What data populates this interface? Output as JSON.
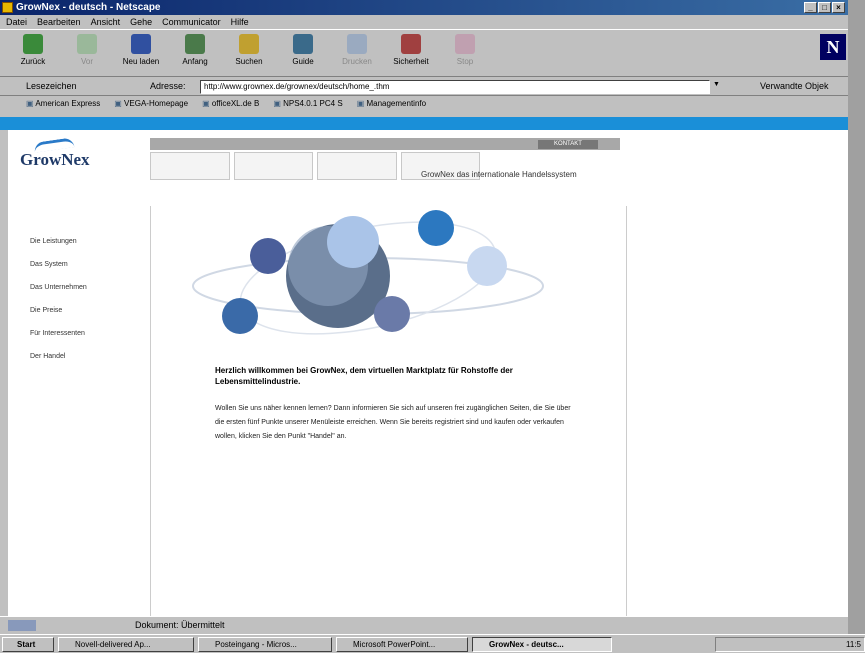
{
  "window": {
    "title": "GrowNex - deutsch - Netscape"
  },
  "menu": [
    "Datei",
    "Bearbeiten",
    "Ansicht",
    "Gehe",
    "Communicator",
    "Hilfe"
  ],
  "toolbar": {
    "buttons": [
      "Zurück",
      "Vor",
      "Neu laden",
      "Anfang",
      "Suchen",
      "Guide",
      "Drucken",
      "Sicherheit",
      "Stop"
    ]
  },
  "location": {
    "bookmarks_label": "Lesezeichen",
    "address_label": "Adresse:",
    "url": "http://www.grownex.de/grownex/deutsch/home_.thm",
    "related_label": "Verwandte Objek"
  },
  "personal_bar": [
    "American Express",
    "VEGA-Homepage",
    "officeXL.de B",
    "NPS4.0.1 PC4 S",
    "Managementinfo"
  ],
  "page": {
    "logo": "GrowNex",
    "kontakt": "KONTAKT",
    "tagline": "GrowNex das internationale Handelssystem",
    "nav": [
      "Die Leistungen",
      "Das System",
      "Das Unternehmen",
      "Die Preise",
      "Für Interessenten",
      "Der Handel"
    ],
    "welcome": "Herzlich willkommen bei GrowNex, dem virtuellen Marktplatz für Rohstoffe der Lebensmittelindustrie.",
    "body": "Wollen Sie uns näher kennen lernen? Dann informieren Sie sich auf unseren frei zugänglichen Seiten, die Sie über die ersten fünf Punkte unserer Menüleiste erreichen. Wenn Sie bereits registriert sind und kaufen oder verkaufen wollen, klicken Sie den Punkt \"Handel\" an."
  },
  "status": {
    "text": "Dokument: Übermittelt"
  },
  "taskbar": {
    "start": "Start",
    "tasks": [
      "Novell-delivered Ap...",
      "Posteingang - Micros...",
      "Microsoft PowerPoint...",
      "GrowNex - deutsc..."
    ],
    "clock": "11:5"
  },
  "colors": {
    "brand_blue": "#1a8fd8",
    "title_blue": "#0a246a"
  }
}
